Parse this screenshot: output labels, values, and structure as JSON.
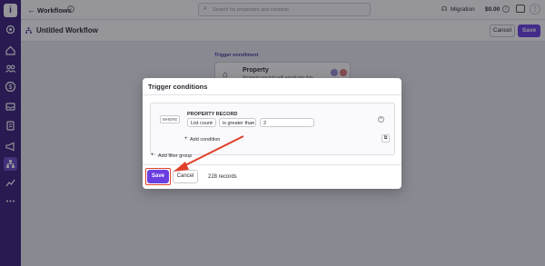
{
  "colors": {
    "sidebar": "#3b1f7a",
    "accent": "#6a3ee0",
    "annotation": "#e0402a"
  },
  "sidebar": {
    "logo": "i",
    "icons": [
      "settings-gear-icon",
      "home-icon",
      "people-icon",
      "dollar-icon",
      "inbox-icon",
      "ledger-icon",
      "megaphone-icon",
      "workflow-icon",
      "analytics-icon",
      "more-icon"
    ]
  },
  "topbar": {
    "back_label": "Workflows",
    "search_placeholder": "Search for properties and contacts",
    "migration_label": "Migration",
    "balance": "$0.00"
  },
  "subbar": {
    "title": "Untitled Workflow",
    "cancel_label": "Cancel",
    "save_label": "Save"
  },
  "canvas": {
    "trigger_label": "Trigger enrollment",
    "card_title": "Property",
    "card_desc": "Property records will enroll into this"
  },
  "modal": {
    "title": "Trigger conditions",
    "where_label": "WHERE",
    "group_title": "PROPERTY RECORD",
    "field_select": "List count",
    "operator_select": "is greater than",
    "value": "2",
    "add_condition_label": "Add condition",
    "add_filter_group_label": "Add filter group",
    "save_label": "Save",
    "cancel_label": "Cancel",
    "records_count": "228 records"
  }
}
